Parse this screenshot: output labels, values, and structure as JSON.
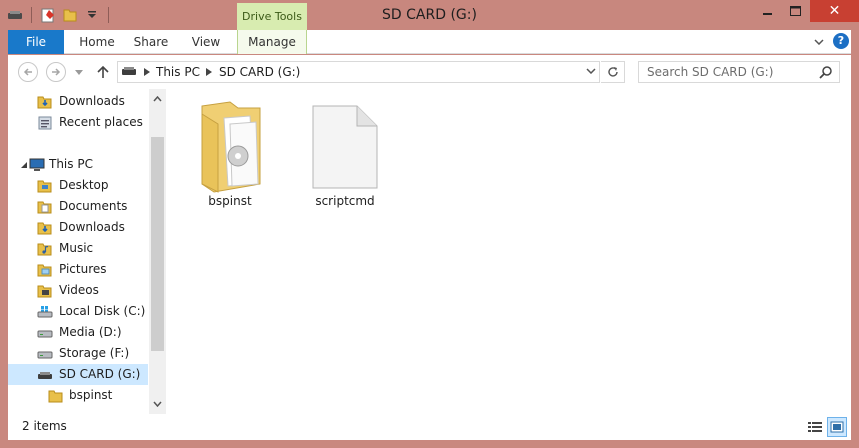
{
  "window": {
    "title": "SD CARD (G:)",
    "contextual_tab": "Drive Tools",
    "close_glyph": "✕"
  },
  "ribbon": {
    "tabs": [
      {
        "label": "File",
        "active": true
      },
      {
        "label": "Home"
      },
      {
        "label": "Share"
      },
      {
        "label": "View"
      },
      {
        "label": "Manage"
      }
    ],
    "help_glyph": "?"
  },
  "address": {
    "crumbs": [
      "This PC",
      "SD CARD (G:)"
    ],
    "search_placeholder": "Search SD CARD (G:)"
  },
  "nav_pane": {
    "items": [
      {
        "label": "Downloads",
        "icon": "downloads-folder-icon"
      },
      {
        "label": "Recent places",
        "icon": "recent-places-icon"
      },
      {
        "label": "This PC",
        "icon": "computer-icon"
      },
      {
        "label": "Desktop",
        "icon": "desktop-folder-icon"
      },
      {
        "label": "Documents",
        "icon": "documents-folder-icon"
      },
      {
        "label": "Downloads",
        "icon": "downloads-folder-icon"
      },
      {
        "label": "Music",
        "icon": "music-folder-icon"
      },
      {
        "label": "Pictures",
        "icon": "pictures-folder-icon"
      },
      {
        "label": "Videos",
        "icon": "videos-folder-icon"
      },
      {
        "label": "Local Disk (C:)",
        "icon": "windows-drive-icon"
      },
      {
        "label": "Media (D:)",
        "icon": "hard-drive-icon"
      },
      {
        "label": "Storage (F:)",
        "icon": "hard-drive-icon"
      },
      {
        "label": "SD CARD (G:)",
        "icon": "sd-card-drive-icon",
        "selected": true
      },
      {
        "label": "bspinst",
        "icon": "folder-icon"
      }
    ]
  },
  "content": {
    "items": [
      {
        "name": "bspinst",
        "type": "folder",
        "icon": "folder-icon"
      },
      {
        "name": "scriptcmd",
        "type": "file",
        "icon": "blank-file-icon"
      }
    ]
  },
  "status": {
    "item_count": "2 items"
  },
  "colors": {
    "titlebar": "#c8877e",
    "file_tab": "#1979ca",
    "selection": "#cde8ff",
    "close_button": "#c84032",
    "contextual_tab": "#d8ecb0"
  }
}
